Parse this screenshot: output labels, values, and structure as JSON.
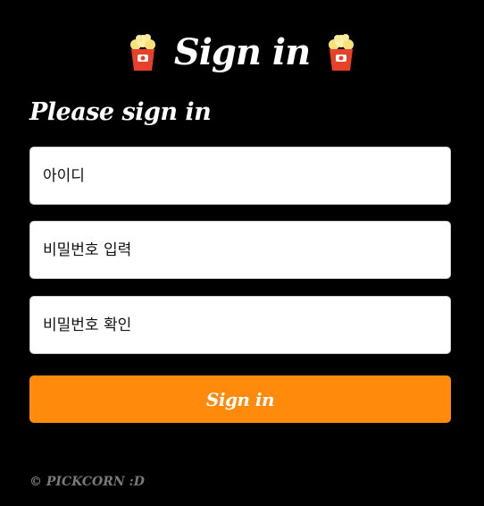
{
  "header": {
    "title": "Sign in",
    "left_icon": "popcorn-icon",
    "right_icon": "popcorn-icon"
  },
  "form": {
    "subtitle": "Please sign in",
    "username_placeholder": "아이디",
    "password_placeholder": "비밀번호 입력",
    "password_confirm_placeholder": "비밀번호 확인",
    "submit_label": "Sign in"
  },
  "footer": {
    "text": "© PICKCORN :D"
  },
  "colors": {
    "background": "#000000",
    "accent": "#ff8a0c",
    "popcorn_box": "#e8412a",
    "popcorn_kernels": "#f7e27a",
    "footer_text": "#7a7a7a"
  }
}
